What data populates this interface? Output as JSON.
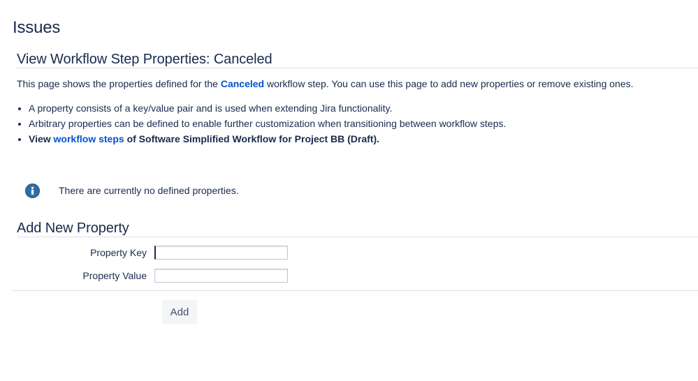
{
  "page": {
    "title": "Issues"
  },
  "view_section": {
    "title": "View Workflow Step Properties: Canceled",
    "intro_before": "This page shows the properties defined for the ",
    "intro_link": "Canceled",
    "intro_after": " workflow step. You can use this page to add new properties or remove existing ones.",
    "bullets": [
      "A property consists of a key/value pair and is used when extending Jira functionality.",
      "Arbitrary properties can be defined to enable further customization when transitioning between workflow steps."
    ],
    "view_bullet": {
      "before": "View ",
      "link": "workflow steps",
      "after": " of Software Simplified Workflow for Project BB (Draft)."
    }
  },
  "info_message": {
    "icon": "info-icon",
    "text": "There are currently no defined properties.",
    "icon_color": "#2f6ea3"
  },
  "add_section": {
    "title": "Add New Property",
    "key_label": "Property Key",
    "key_value": "",
    "value_label": "Property Value",
    "value_value": "",
    "submit_label": "Add"
  },
  "colors": {
    "text": "#172b4d",
    "link": "#0052cc",
    "divider": "#dfe1e6",
    "button_bg": "#f4f5f7",
    "button_text": "#42526e"
  }
}
